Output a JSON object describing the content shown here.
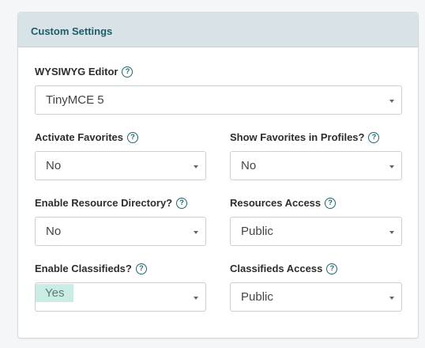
{
  "panel": {
    "title": "Custom Settings"
  },
  "fields": {
    "wysiwyg": {
      "label": "WYSIWYG Editor",
      "value": "TinyMCE 5"
    },
    "activate_favorites": {
      "label": "Activate Favorites",
      "value": "No"
    },
    "show_favorites": {
      "label": "Show Favorites in Profiles?",
      "value": "No"
    },
    "enable_resource_dir": {
      "label": "Enable Resource Directory?",
      "value": "No"
    },
    "resources_access": {
      "label": "Resources Access",
      "value": "Public"
    },
    "enable_classifieds": {
      "label": "Enable Classifieds?",
      "value": "Yes"
    },
    "classifieds_access": {
      "label": "Classifieds Access",
      "value": "Public"
    }
  },
  "icons": {
    "help": "question-circle-icon",
    "caret": "chevron-down-icon"
  },
  "help_glyph": "?",
  "colors": {
    "header_bg": "#d8e3e8",
    "title": "#1d5c69",
    "help_icon": "#1d6674",
    "highlight": "#c9ece4"
  }
}
